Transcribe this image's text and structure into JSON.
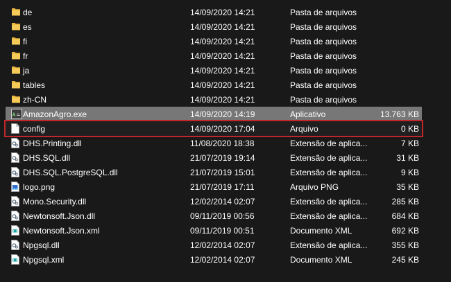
{
  "files": [
    {
      "name": "de",
      "date": "14/09/2020 14:21",
      "type": "Pasta de arquivos",
      "size": "",
      "icon": "folder-icon",
      "state": "normal"
    },
    {
      "name": "es",
      "date": "14/09/2020 14:21",
      "type": "Pasta de arquivos",
      "size": "",
      "icon": "folder-icon",
      "state": "normal"
    },
    {
      "name": "fi",
      "date": "14/09/2020 14:21",
      "type": "Pasta de arquivos",
      "size": "",
      "icon": "folder-icon",
      "state": "normal"
    },
    {
      "name": "fr",
      "date": "14/09/2020 14:21",
      "type": "Pasta de arquivos",
      "size": "",
      "icon": "folder-icon",
      "state": "normal"
    },
    {
      "name": "ja",
      "date": "14/09/2020 14:21",
      "type": "Pasta de arquivos",
      "size": "",
      "icon": "folder-icon",
      "state": "normal"
    },
    {
      "name": "tables",
      "date": "14/09/2020 14:21",
      "type": "Pasta de arquivos",
      "size": "",
      "icon": "folder-icon",
      "state": "normal"
    },
    {
      "name": "zh-CN",
      "date": "14/09/2020 14:21",
      "type": "Pasta de arquivos",
      "size": "",
      "icon": "folder-icon",
      "state": "normal"
    },
    {
      "name": "AmazonAgro.exe",
      "date": "14/09/2020 14:19",
      "type": "Aplicativo",
      "size": "13.763 KB",
      "icon": "app-icon",
      "state": "selected"
    },
    {
      "name": "config",
      "date": "14/09/2020 17:04",
      "type": "Arquivo",
      "size": "0 KB",
      "icon": "blank-file-icon",
      "state": "highlighted"
    },
    {
      "name": "DHS.Printing.dll",
      "date": "11/08/2020 18:38",
      "type": "Extensão de aplica...",
      "size": "7 KB",
      "icon": "dll-file-icon",
      "state": "normal"
    },
    {
      "name": "DHS.SQL.dll",
      "date": "21/07/2019 19:14",
      "type": "Extensão de aplica...",
      "size": "31 KB",
      "icon": "dll-file-icon",
      "state": "normal"
    },
    {
      "name": "DHS.SQL.PostgreSQL.dll",
      "date": "21/07/2019 15:01",
      "type": "Extensão de aplica...",
      "size": "9 KB",
      "icon": "dll-file-icon",
      "state": "normal"
    },
    {
      "name": "logo.png",
      "date": "21/07/2019 17:11",
      "type": "Arquivo PNG",
      "size": "35 KB",
      "icon": "image-file-icon",
      "state": "normal"
    },
    {
      "name": "Mono.Security.dll",
      "date": "12/02/2014 02:07",
      "type": "Extensão de aplica...",
      "size": "285 KB",
      "icon": "dll-file-icon",
      "state": "normal"
    },
    {
      "name": "Newtonsoft.Json.dll",
      "date": "09/11/2019 00:56",
      "type": "Extensão de aplica...",
      "size": "684 KB",
      "icon": "dll-file-icon",
      "state": "normal"
    },
    {
      "name": "Newtonsoft.Json.xml",
      "date": "09/11/2019 00:51",
      "type": "Documento XML",
      "size": "692 KB",
      "icon": "xml-file-icon",
      "state": "normal"
    },
    {
      "name": "Npgsql.dll",
      "date": "12/02/2014 02:07",
      "type": "Extensão de aplica...",
      "size": "355 KB",
      "icon": "dll-file-icon",
      "state": "normal"
    },
    {
      "name": "Npgsql.xml",
      "date": "12/02/2014 02:07",
      "type": "Documento XML",
      "size": "245 KB",
      "icon": "xml-file-icon",
      "state": "normal"
    }
  ],
  "colors": {
    "background": "#191919",
    "selection": "#777777",
    "highlight_border": "#c0262a",
    "text": "#ffffff",
    "folder": "#e8b53d"
  }
}
